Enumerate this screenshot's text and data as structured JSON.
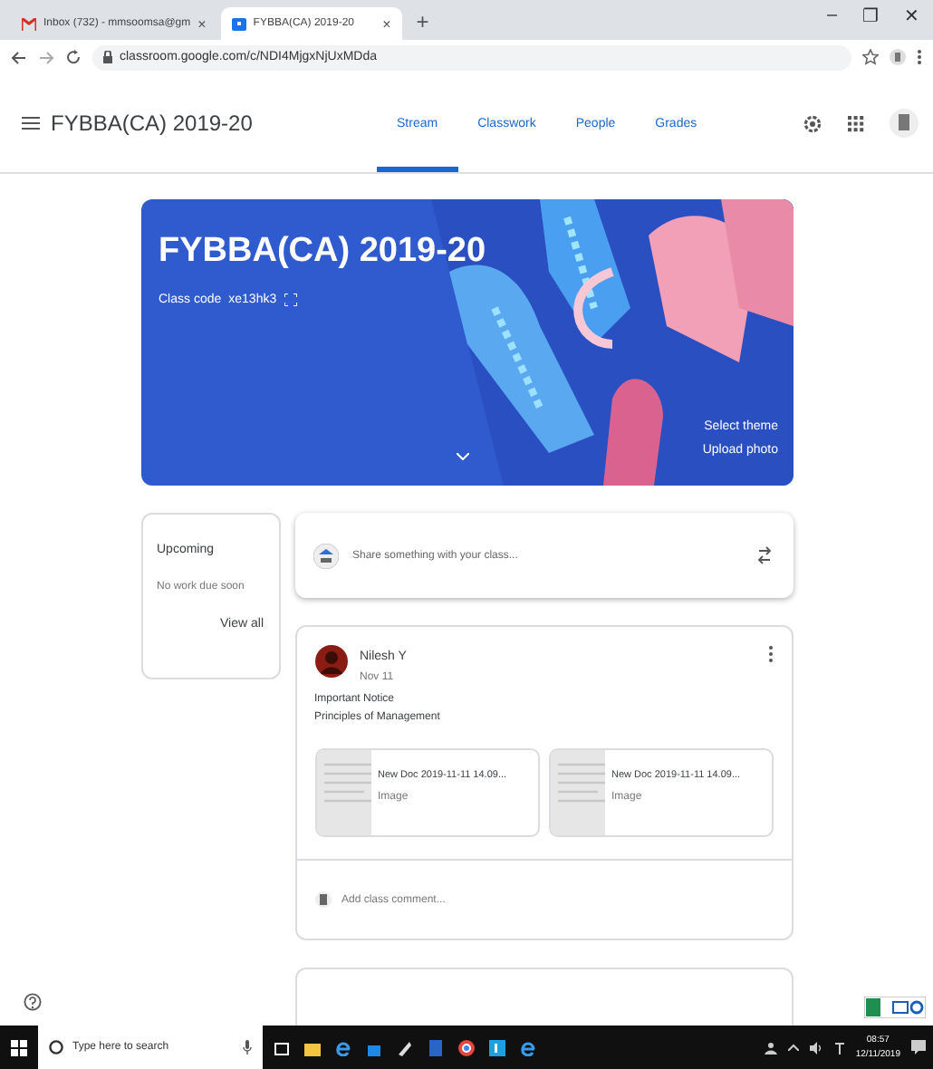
{
  "browser": {
    "tabs": [
      {
        "label": "Inbox (732) - mmsoomsa@gm",
        "selected": false,
        "close": "×"
      },
      {
        "label": "FYBBA(CA) 2019-20",
        "selected": true,
        "close": "×"
      }
    ],
    "new_tab": "+",
    "window_controls": [
      "–",
      "❐",
      "✕"
    ],
    "url": "classroom.google.com/c/NDI4MjgxNjUxMDda"
  },
  "header": {
    "title": "FYBBA(CA) 2019-20",
    "nav": [
      {
        "label": "Stream",
        "selected": true
      },
      {
        "label": "Classwork",
        "selected": false
      },
      {
        "label": "People",
        "selected": false
      },
      {
        "label": "Grades",
        "selected": false
      }
    ]
  },
  "banner": {
    "title": "FYBBA(CA) 2019-20",
    "class_code_label": "Class code",
    "class_code": "xe13hk3",
    "links": [
      "Select theme",
      "Upload photo"
    ]
  },
  "upcoming": {
    "title": "Upcoming",
    "message": "No work due soon",
    "link": "View all"
  },
  "share": {
    "placeholder": "Share something with your class..."
  },
  "post": {
    "author": "Nilesh Y",
    "date": "Nov 11",
    "lines": [
      "Important Notice",
      "Principles of Management"
    ],
    "attachments": [
      {
        "title": "New Doc 2019-11-11 14.09...",
        "type": "Image"
      },
      {
        "title": "New Doc 2019-11-11 14.09...",
        "type": "Image"
      }
    ],
    "comment_placeholder": "Add class comment..."
  },
  "taskbar": {
    "search_placeholder": "Type here to search",
    "time": "08:57",
    "date": "12/11/2019"
  }
}
